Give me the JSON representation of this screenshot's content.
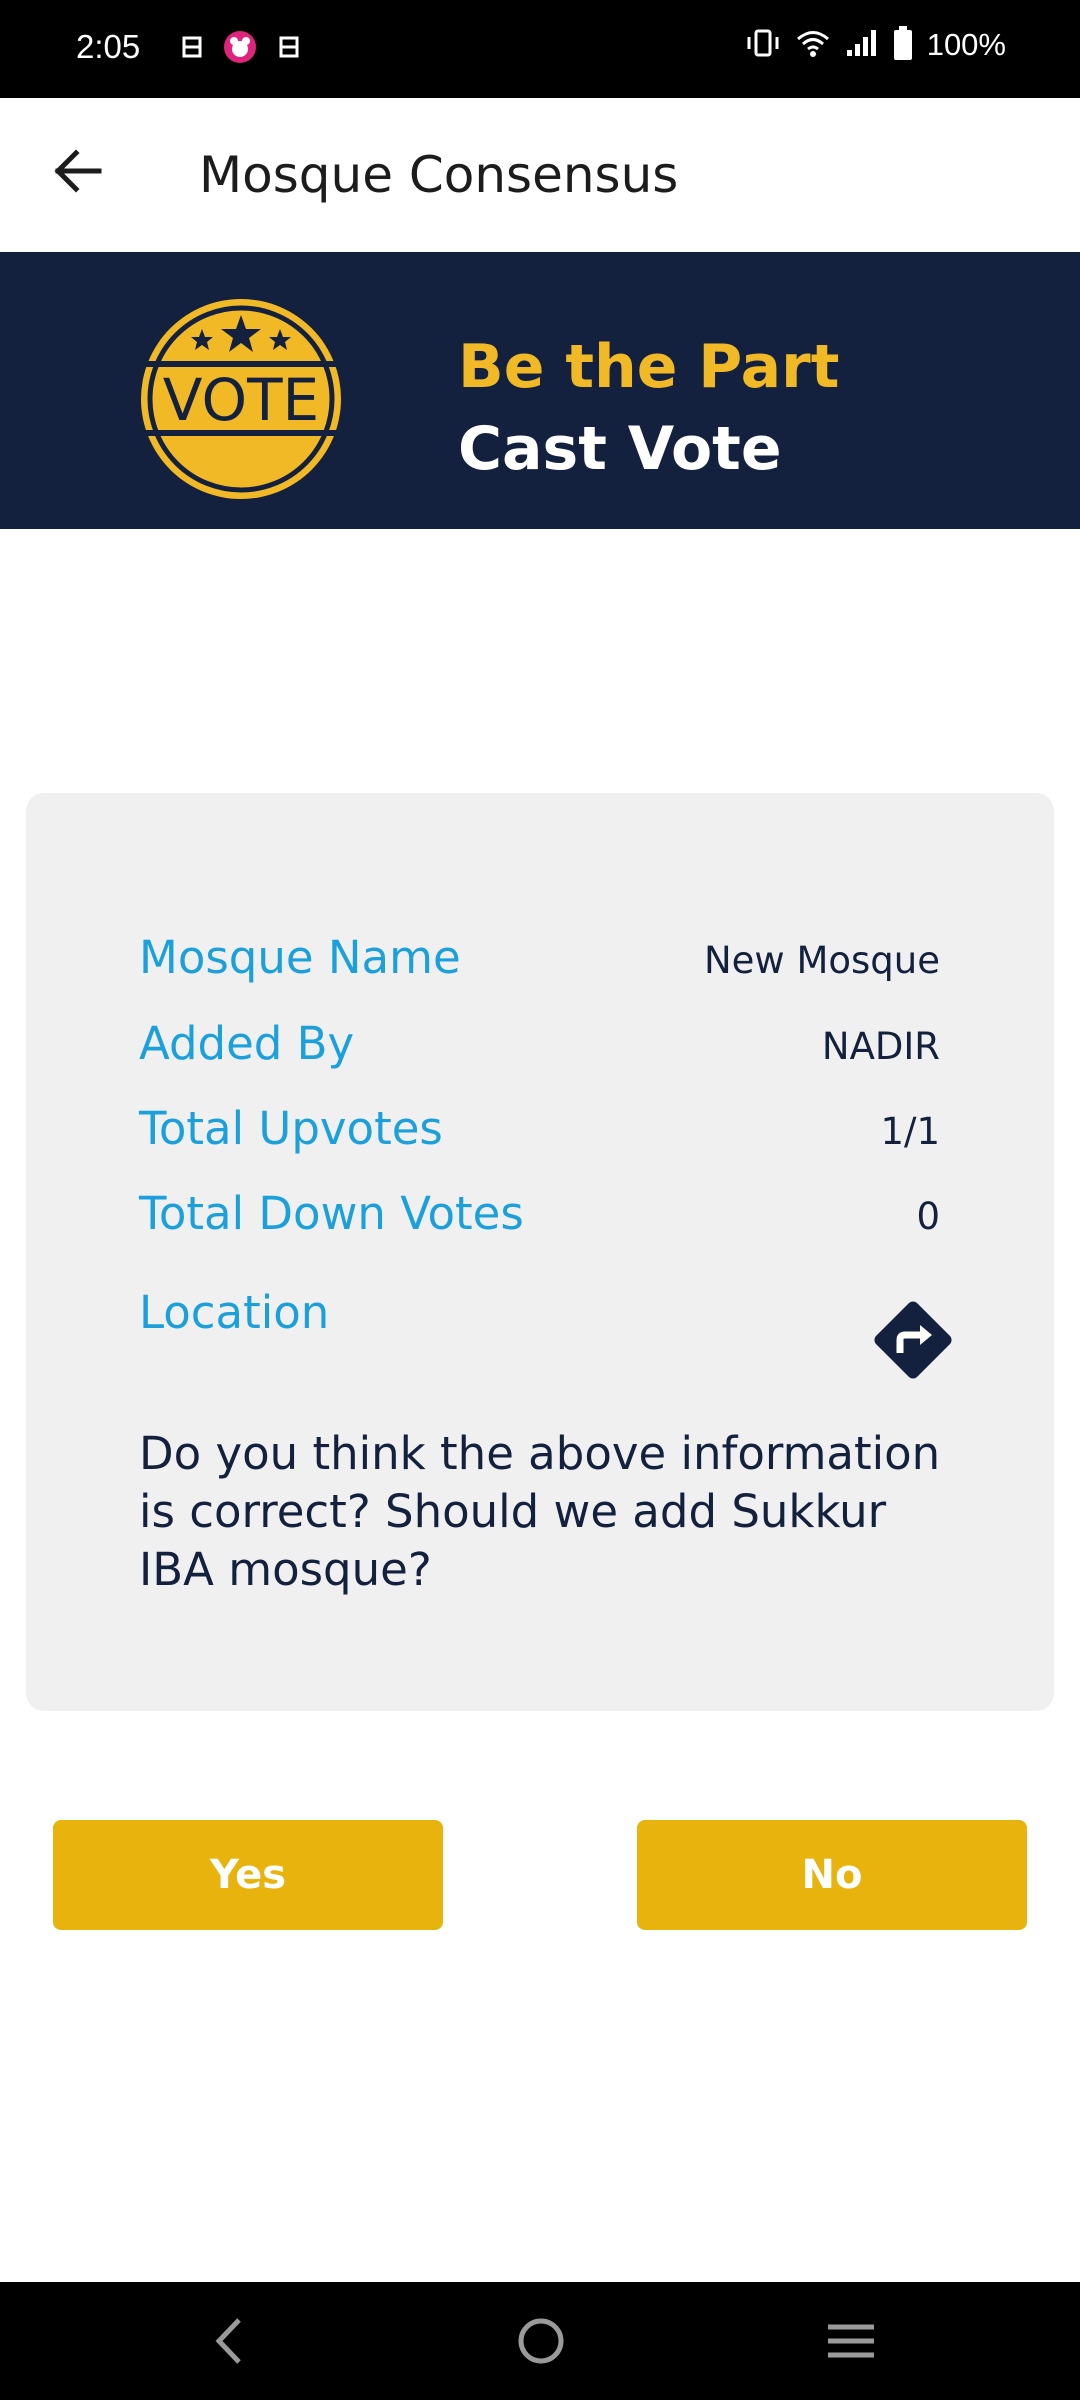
{
  "status_bar": {
    "time": "2:05",
    "battery": "100%",
    "icons": [
      "notification-icon",
      "panda-app-icon",
      "notification-icon",
      "vibrate-icon",
      "wifi-icon",
      "signal-icon",
      "battery-icon"
    ]
  },
  "app_bar": {
    "title": "Mosque Consensus",
    "back_icon": "arrow-left-icon"
  },
  "banner": {
    "logo_text": "VOTE",
    "line1": "Be the Part",
    "line2": "Cast Vote"
  },
  "details": {
    "rows": [
      {
        "label": "Mosque Name",
        "value": "New Mosque"
      },
      {
        "label": "Added By",
        "value": "NADIR"
      },
      {
        "label": "Total Upvotes",
        "value": "1/1"
      },
      {
        "label": "Total Down Votes",
        "value": "0"
      }
    ],
    "location_label": "Location",
    "location_icon": "directions-icon"
  },
  "question": "Do you think the above information is correct? Should we add Sukkur IBA mosque?",
  "actions": {
    "yes_label": "Yes",
    "no_label": "No"
  },
  "colors": {
    "banner_bg": "#13213f",
    "accent_yellow": "#f2b927",
    "button_yellow": "#e8b30c",
    "label_blue": "#1ca0dc",
    "card_bg": "#f0f0f0"
  }
}
